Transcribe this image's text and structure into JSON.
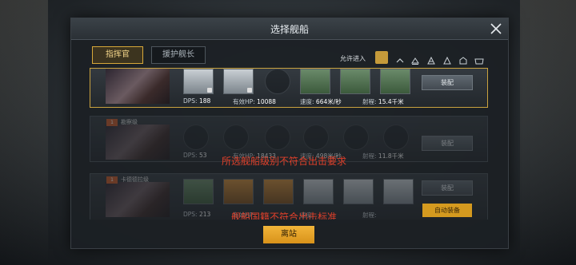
{
  "dialog": {
    "title": "选择舰船",
    "tabs": [
      {
        "label": "指挥官"
      },
      {
        "label": "援护舰长"
      }
    ],
    "allow_label": "允许进入",
    "filter_icons": [
      "chevron-up-icon",
      "frigate-icon",
      "destroyer-icon",
      "cruiser-icon",
      "battlecruiser-icon",
      "carrier-icon"
    ]
  },
  "rows": [
    {
      "stats": {
        "dps_label": "DPS:",
        "dps": "188",
        "hp_label": "有效HP:",
        "hp": "10088",
        "speed_label": "速度:",
        "speed": "664米/秒",
        "range_label": "射程:",
        "range": "15.4千米"
      },
      "equip_label": "装配"
    },
    {
      "tier": "1",
      "name": "勘察级",
      "stats": {
        "dps_label": "DPS:",
        "dps": "53",
        "hp_label": "有效HP:",
        "hp": "18433",
        "speed_label": "速度:",
        "speed": "498米/秒",
        "range_label": "射程:",
        "range": "11.8千米"
      },
      "equip_label": "装配",
      "warning": "所选舰船级别不符合出击要求"
    },
    {
      "tier": "1",
      "name": "卡德德拉级",
      "stats": {
        "dps_label": "DPS:",
        "dps": "213",
        "hp_label": "有效HP:",
        "hp": "",
        "speed_label": "速度:",
        "speed": "",
        "range_label": "射程:",
        "range": ""
      },
      "equip_label": "装配",
      "auto_label": "自动装备",
      "warning": "舰船国籍不符合出击标准"
    }
  ],
  "leave_label": "离站"
}
